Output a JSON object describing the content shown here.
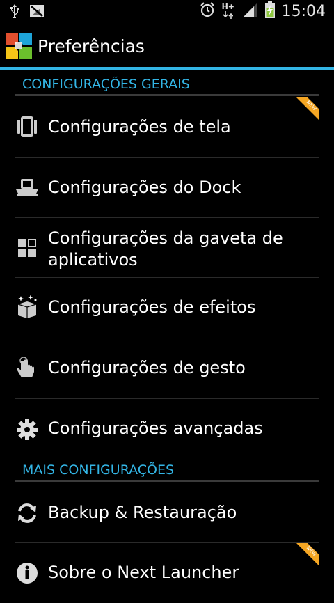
{
  "status_bar": {
    "time": "15:04",
    "network": "H+"
  },
  "action_bar": {
    "title": "Preferências"
  },
  "sections": [
    {
      "header": "CONFIGURAÇÕES GERAIS"
    },
    {
      "header": "MAIS CONFIGURAÇÕES"
    }
  ],
  "items": [
    {
      "label": "Configurações de tela",
      "icon": "screen-icon",
      "badge": "NEW"
    },
    {
      "label": "Configurações do Dock",
      "icon": "dock-icon"
    },
    {
      "label": "Configurações da gaveta de aplicativos",
      "icon": "app-drawer-icon"
    },
    {
      "label": "Configurações de efeitos",
      "icon": "effects-icon"
    },
    {
      "label": "Configurações de gesto",
      "icon": "gesture-icon"
    },
    {
      "label": "Configurações avançadas",
      "icon": "gear-icon"
    },
    {
      "label": "Backup & Restauração",
      "icon": "refresh-icon"
    },
    {
      "label": "Sobre o Next Launcher",
      "icon": "info-icon",
      "badge": "NEW"
    }
  ],
  "colors": {
    "accent": "#33b5e5",
    "badge": "#f5a623"
  }
}
